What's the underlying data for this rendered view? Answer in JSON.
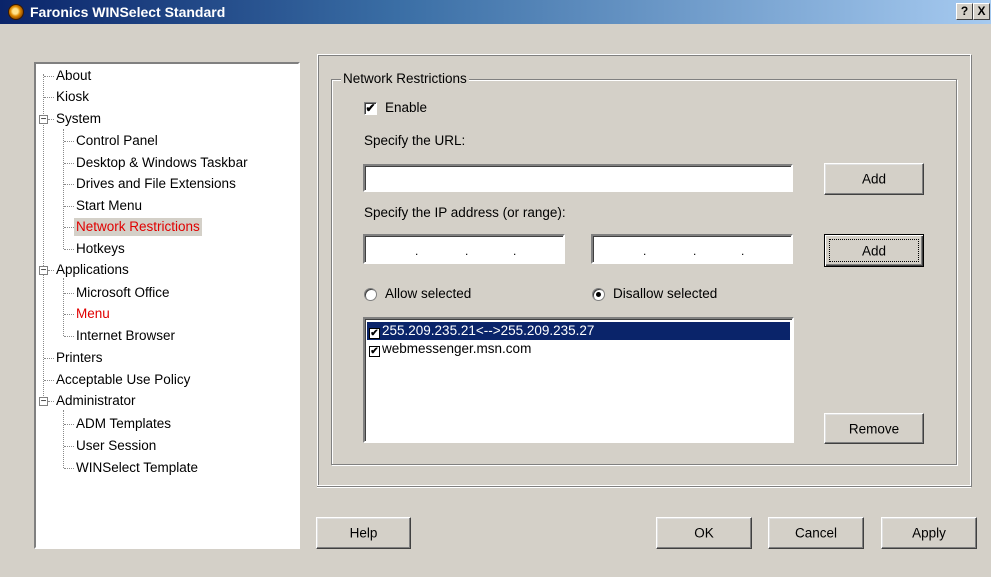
{
  "window": {
    "title": "Faronics WINSelect Standard",
    "help_btn": "?",
    "close_btn": "X"
  },
  "tree": {
    "items": [
      {
        "label": "About"
      },
      {
        "label": "Kiosk"
      },
      {
        "label": "System",
        "toggle": "−"
      },
      {
        "label": "Control Panel"
      },
      {
        "label": "Desktop & Windows Taskbar"
      },
      {
        "label": "Drives and File Extensions"
      },
      {
        "label": "Start Menu"
      },
      {
        "label": "Network Restrictions",
        "highlight": "red-selected"
      },
      {
        "label": "Hotkeys"
      },
      {
        "label": "Applications",
        "toggle": "−"
      },
      {
        "label": "Microsoft Office"
      },
      {
        "label": "Menu",
        "highlight": "red"
      },
      {
        "label": "Internet Browser"
      },
      {
        "label": "Printers"
      },
      {
        "label": "Acceptable Use Policy"
      },
      {
        "label": "Administrator",
        "toggle": "−"
      },
      {
        "label": "ADM Templates"
      },
      {
        "label": "User Session"
      },
      {
        "label": "WINSelect Template"
      }
    ]
  },
  "group": {
    "title": "Network Restrictions",
    "enable_label": "Enable",
    "enable_checked": "✔",
    "url_label": "Specify the URL:",
    "url_value": "",
    "add_url_label": "Add",
    "ip_label": "Specify the IP address (or range):",
    "ip_dots": ".",
    "add_ip_label": "Add",
    "allow_label": "Allow selected",
    "disallow_label": "Disallow selected",
    "selected_mode": "disallow",
    "list": [
      {
        "text": "255.209.235.21<-->255.209.235.27",
        "checked": "✔",
        "selected": true
      },
      {
        "text": "webmessenger.msn.com",
        "checked": "✔",
        "selected": false
      }
    ],
    "remove_label": "Remove"
  },
  "footer": {
    "help_label": "Help",
    "ok_label": "OK",
    "cancel_label": "Cancel",
    "apply_label": "Apply"
  },
  "colors": {
    "title_bar": "#0a246a",
    "selection": "#0a246a",
    "highlight_text": "#e00000",
    "face": "#d4d0c8"
  }
}
